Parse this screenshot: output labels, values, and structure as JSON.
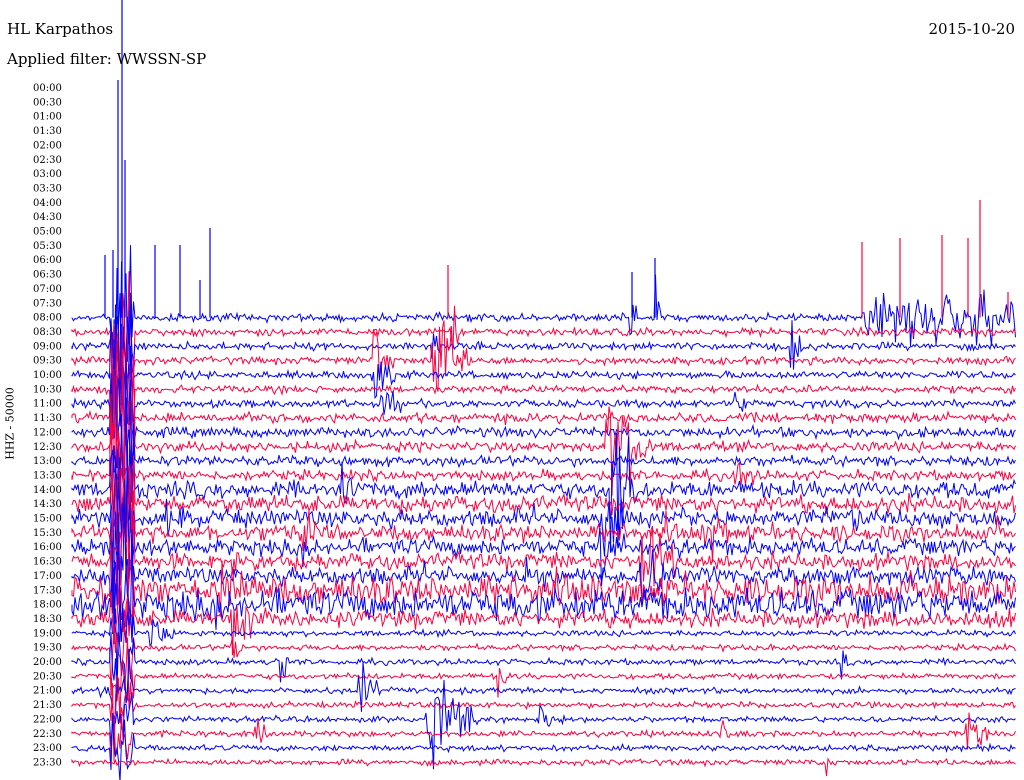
{
  "header": {
    "station": "HL Karpathos",
    "filter": "Applied filter: WWSSN-SP",
    "date": "2015-10-20"
  },
  "chart_data": {
    "type": "line",
    "title": "HL Karpathos",
    "ylabel": "HHZ - 50000",
    "trace_colors": [
      "#0000ff",
      "#ff0040"
    ],
    "row_labels": [
      "00:00",
      "00:30",
      "01:00",
      "01:30",
      "02:00",
      "02:30",
      "03:00",
      "03:30",
      "04:00",
      "04:30",
      "05:00",
      "05:30",
      "06:00",
      "06:30",
      "07:00",
      "07:30",
      "08:00",
      "08:30",
      "09:00",
      "09:30",
      "10:00",
      "10:30",
      "11:00",
      "11:30",
      "12:00",
      "12:30",
      "13:00",
      "13:30",
      "14:00",
      "14:30",
      "15:00",
      "15:30",
      "16:00",
      "16:30",
      "17:00",
      "17:30",
      "18:00",
      "18:30",
      "19:00",
      "19:30",
      "20:00",
      "20:30",
      "21:00",
      "21:30",
      "22:00",
      "22:30",
      "23:00",
      "23:30"
    ],
    "first_recorded_row": "08:00"
  }
}
